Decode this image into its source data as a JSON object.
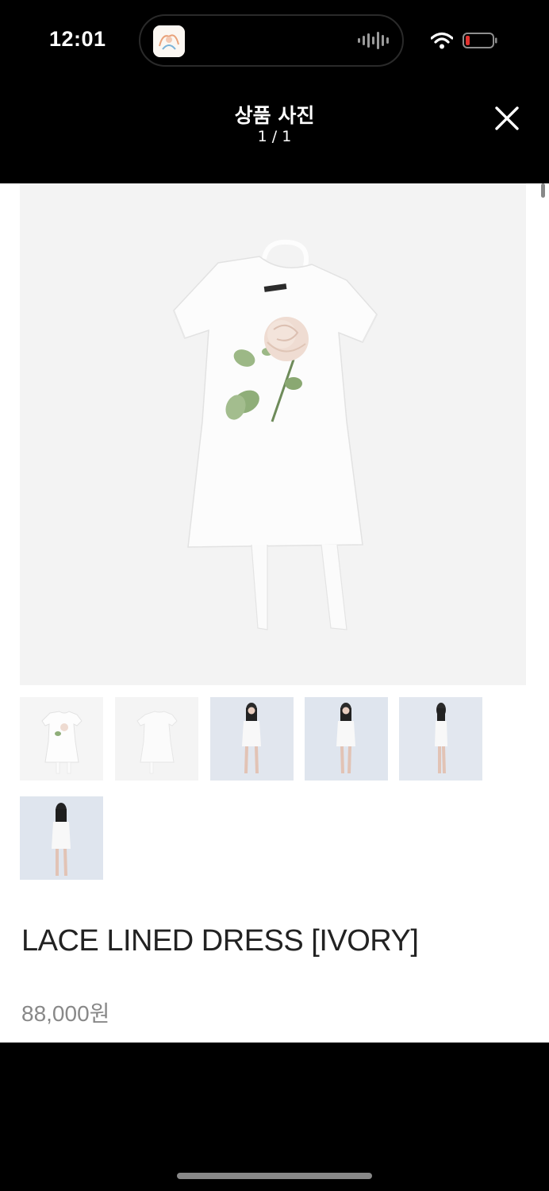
{
  "status_bar": {
    "time": "12:01",
    "icons": [
      "app-thumbnail-icon",
      "audio-wave-icon",
      "wifi-icon",
      "battery-icon"
    ],
    "battery_level_color": "#e0322f"
  },
  "header": {
    "title": "상품 사진",
    "counter": "1 / 1",
    "close_icon": "close-icon"
  },
  "gallery": {
    "main_image": "white short-sleeve dress with rose print and halter tie",
    "thumbnails": [
      {
        "subject": "dress front, flat lay"
      },
      {
        "subject": "dress back, flat lay"
      },
      {
        "subject": "model wearing dress, front"
      },
      {
        "subject": "model wearing dress, front"
      },
      {
        "subject": "model wearing dress, side"
      },
      {
        "subject": "model wearing dress, back"
      }
    ]
  },
  "product": {
    "name": "LACE LINED DRESS [IVORY]",
    "price": "88,000원"
  }
}
